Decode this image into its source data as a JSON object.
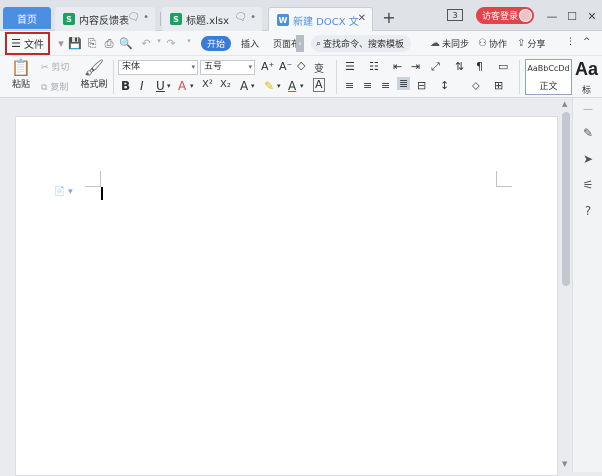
{
  "tabs": {
    "home": "首页",
    "items": [
      {
        "icon": "S",
        "label": "内容反馈表",
        "trail": "🗨 •"
      },
      {
        "icon": "S",
        "label": "标题.xlsx",
        "trail": "🗨 •"
      },
      {
        "icon": "W",
        "label": "新建 DOCX 文",
        "trail": "✕"
      }
    ],
    "new_tab": "+"
  },
  "window": {
    "page_badge": "3",
    "visitor_login": "访客登录",
    "minimize": "—",
    "maximize": "☐",
    "close": "✕"
  },
  "commandbar": {
    "file_label": "文件",
    "start": "开始",
    "insert": "插入",
    "page_layout": "页面布",
    "search_placeholder": "查找命令、搜索模板",
    "not_synced": "未同步",
    "collaborate": "协作",
    "share": "分享",
    "more": "⋮",
    "collapse": "^"
  },
  "ribbon": {
    "paste": "粘贴",
    "cut": "剪切",
    "copy": "复制",
    "format_painter": "格式刷",
    "font_name": "宋体",
    "font_size": "五号",
    "grow_font": "A⁺",
    "shrink_font": "A⁻",
    "clear_format": "◇",
    "phonetic": "变",
    "bold": "B",
    "italic": "I",
    "underline": "U",
    "font_color_a": "A",
    "superscript": "X²",
    "subscript": "X₂",
    "text_effect": "A",
    "highlight": "✎",
    "font_color": "A",
    "char_border": "A",
    "style_sample": "AaBbCcDd",
    "style_normal": "正文",
    "style_heading_sample": "Aa",
    "style_heading": "标"
  },
  "document": {
    "para_marker": "📄 ▾"
  }
}
